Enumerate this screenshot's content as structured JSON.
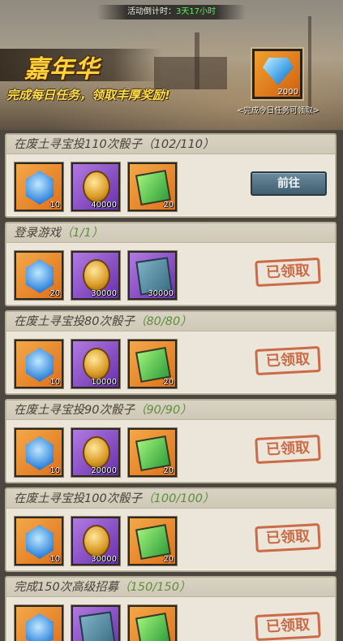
{
  "header": {
    "countdown_label": "活动倒计时：",
    "countdown_value": "3天17小时",
    "title": "嘉年华",
    "subtitle": "完成每日任务，领取丰厚奖励!",
    "daily_reward": {
      "icon": "blue-diamond-icon",
      "quantity": "2000",
      "caption": "<完成今日任务可领取>"
    }
  },
  "tasks": [
    {
      "title": "在废土寻宝投110次骰子",
      "progress": "（102/110）",
      "completed": false,
      "action": "前往",
      "rewards": [
        {
          "icon": "blue-gem-icon",
          "qty": "10",
          "frame": "orange"
        },
        {
          "icon": "gold-coin-icon",
          "qty": "40000",
          "frame": "purple"
        },
        {
          "icon": "treasure-map-icon",
          "qty": "20",
          "frame": "orange"
        }
      ]
    },
    {
      "title": "登录游戏",
      "progress": "（1/1）",
      "completed": true,
      "action": "已领取",
      "rewards": [
        {
          "icon": "blue-gem-icon",
          "qty": "20",
          "frame": "orange"
        },
        {
          "icon": "gold-coin-icon",
          "qty": "30000",
          "frame": "purple"
        },
        {
          "icon": "recruit-ticket-icon",
          "qty": "30000",
          "frame": "purple"
        }
      ]
    },
    {
      "title": "在废土寻宝投80次骰子",
      "progress": "（80/80）",
      "completed": true,
      "action": "已领取",
      "rewards": [
        {
          "icon": "blue-gem-icon",
          "qty": "10",
          "frame": "orange"
        },
        {
          "icon": "gold-coin-icon",
          "qty": "10000",
          "frame": "purple"
        },
        {
          "icon": "treasure-map-icon",
          "qty": "20",
          "frame": "orange"
        }
      ]
    },
    {
      "title": "在废土寻宝投90次骰子",
      "progress": "（90/90）",
      "completed": true,
      "action": "已领取",
      "rewards": [
        {
          "icon": "blue-gem-icon",
          "qty": "10",
          "frame": "orange"
        },
        {
          "icon": "gold-coin-icon",
          "qty": "20000",
          "frame": "purple"
        },
        {
          "icon": "treasure-map-icon",
          "qty": "20",
          "frame": "orange"
        }
      ]
    },
    {
      "title": "在废土寻宝投100次骰子",
      "progress": "（100/100）",
      "completed": true,
      "action": "已领取",
      "rewards": [
        {
          "icon": "blue-gem-icon",
          "qty": "10",
          "frame": "orange"
        },
        {
          "icon": "gold-coin-icon",
          "qty": "30000",
          "frame": "purple"
        },
        {
          "icon": "treasure-map-icon",
          "qty": "20",
          "frame": "orange"
        }
      ]
    },
    {
      "title": "完成150次高级招募",
      "progress": "（150/150）",
      "completed": true,
      "action": "已领取",
      "rewards": [
        {
          "icon": "blue-gem-icon",
          "qty": "",
          "frame": "orange"
        },
        {
          "icon": "recruit-ticket-icon",
          "qty": "",
          "frame": "purple"
        },
        {
          "icon": "treasure-map-icon",
          "qty": "",
          "frame": "orange"
        }
      ]
    }
  ]
}
